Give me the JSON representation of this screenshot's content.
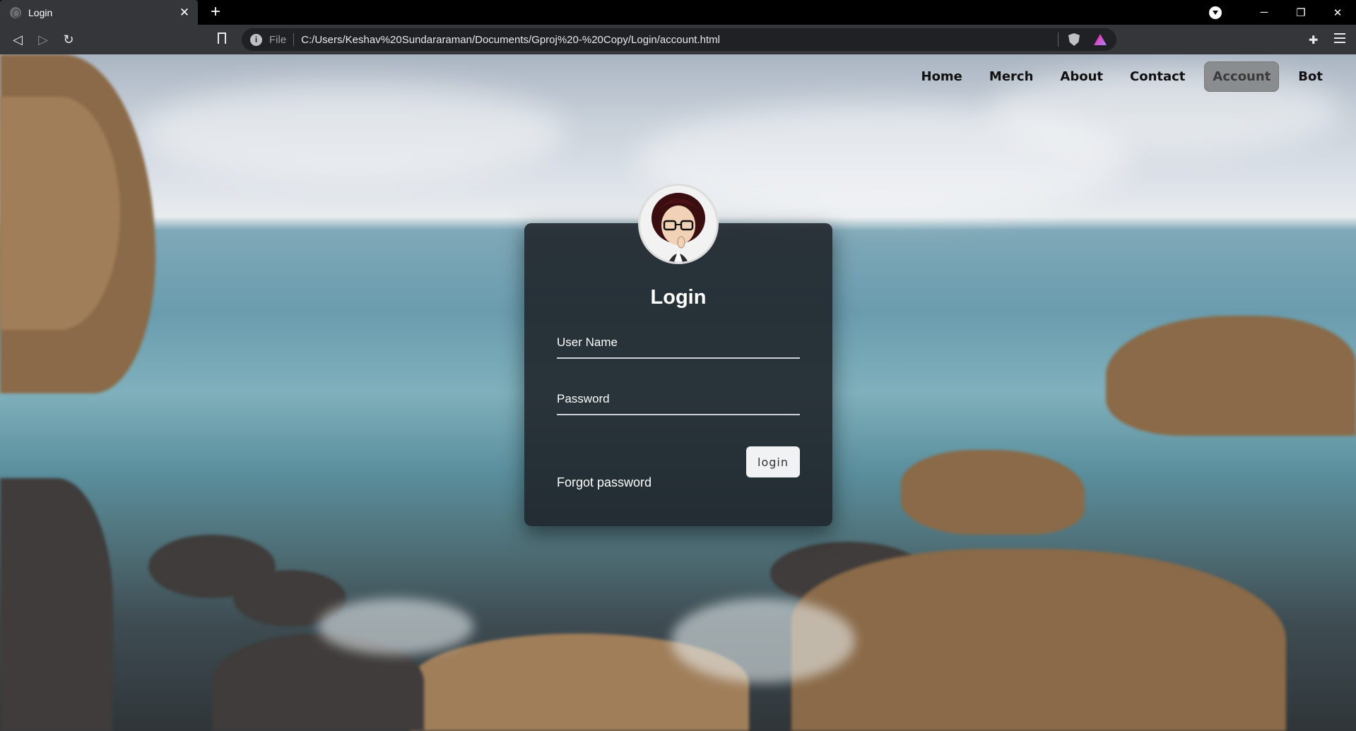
{
  "browser": {
    "tab_title": "Login",
    "tab_close": "✕",
    "new_tab": "+",
    "file_label": "File",
    "url": "C:/Users/Keshav%20Sundararaman/Documents/Gproj%20-%20Copy/Login/account.html",
    "win_minimize": "─",
    "win_restore": "❐",
    "win_close": "✕",
    "back": "◁",
    "forward": "▷",
    "reload": "↻"
  },
  "nav": {
    "items": [
      {
        "label": "Home"
      },
      {
        "label": "Merch"
      },
      {
        "label": "About"
      },
      {
        "label": "Contact"
      },
      {
        "label": "Account",
        "active": true
      },
      {
        "label": "Bot"
      }
    ]
  },
  "login": {
    "title": "Login",
    "username_placeholder": "User Name",
    "password_placeholder": "Password",
    "button_label": "login",
    "forgot_label": "Forgot password"
  },
  "colors": {
    "card_bg": "#1e2228",
    "nav_active_bg": "#8a8d90",
    "browser_chrome": "#35363a"
  }
}
